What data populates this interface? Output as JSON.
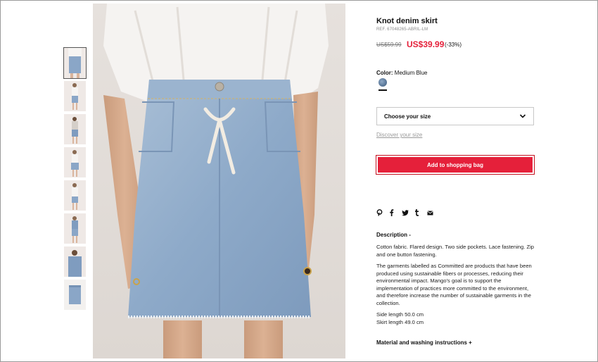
{
  "product": {
    "title": "Knot denim skirt",
    "ref": "REF. 67048265-ABRIL-LM",
    "old_price": "US$59.99",
    "new_price": "US$39.99",
    "discount": "(-33%)"
  },
  "color": {
    "label": "Color:",
    "value": "Medium Blue",
    "swatch_color": "#5f7c9d"
  },
  "size": {
    "select_label": "Choose your size",
    "discover_link": "Discover your size"
  },
  "cart": {
    "button_label": "Add to shopping bag",
    "button_color": "#e5203a"
  },
  "share": {
    "icons": [
      "pinterest-icon",
      "facebook-icon",
      "twitter-icon",
      "tumblr-icon",
      "email-icon"
    ]
  },
  "description": {
    "title": "Description -",
    "p1": "Cotton fabric. Flared design. Two side pockets. Lace fastening. Zip and one button fastening.",
    "p2": "The garments labelled as Committed are products that have been produced using sustainable fibers or processes, reducing their environmental impact. Mango's goal is to support the implementation of practices more committed to the environment, and therefore increase the number of sustainable garments in the collection.",
    "side_length": "Side length 50.0 cm",
    "skirt_length": "Skirt length 49.0 cm"
  },
  "materials": {
    "title": "Material and washing instructions +"
  },
  "thumbnails": {
    "count": 8,
    "active_index": 0
  }
}
